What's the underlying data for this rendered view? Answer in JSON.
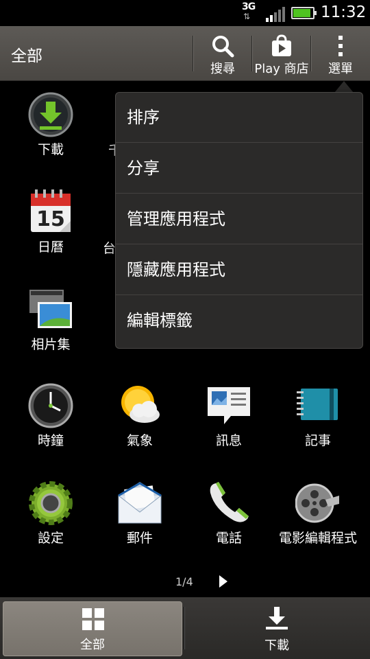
{
  "status_bar": {
    "network": "3G",
    "network_arrows": "⇅",
    "time": "11:32",
    "battery_level": 0.9,
    "battery_color": "#4fc321"
  },
  "action_bar": {
    "title": "全部",
    "buttons": [
      {
        "label": "搜尋",
        "icon": "search-icon"
      },
      {
        "label": "Play 商店",
        "icon": "play-store-icon"
      },
      {
        "label": "選單",
        "icon": "overflow-menu-icon"
      }
    ]
  },
  "apps": [
    {
      "name": "下載",
      "icon": "download-icon"
    },
    {
      "name": "日曆",
      "icon": "calendar-icon",
      "day": "15"
    },
    {
      "name": "相片集",
      "icon": "gallery-icon"
    },
    {
      "name": "時鐘",
      "icon": "clock-icon"
    },
    {
      "name": "氣象",
      "icon": "weather-icon"
    },
    {
      "name": "訊息",
      "icon": "messages-icon"
    },
    {
      "name": "記事",
      "icon": "notes-icon"
    },
    {
      "name": "設定",
      "icon": "settings-gear-icon"
    },
    {
      "name": "郵件",
      "icon": "mail-icon"
    },
    {
      "name": "電話",
      "icon": "phone-icon"
    },
    {
      "name": "電影編輯程式",
      "icon": "film-reel-icon"
    }
  ],
  "partial_labels": [
    "千",
    "台"
  ],
  "pager": {
    "text": "1/4",
    "next_icon": "play-arrow-icon"
  },
  "menu": {
    "items": [
      "排序",
      "分享",
      "管理應用程式",
      "隱藏應用程式",
      "編輯標籤"
    ]
  },
  "bottom_tabs": [
    {
      "label": "全部",
      "icon": "grid-icon",
      "selected": true
    },
    {
      "label": "下載",
      "icon": "download-tray-icon",
      "selected": false
    }
  ]
}
